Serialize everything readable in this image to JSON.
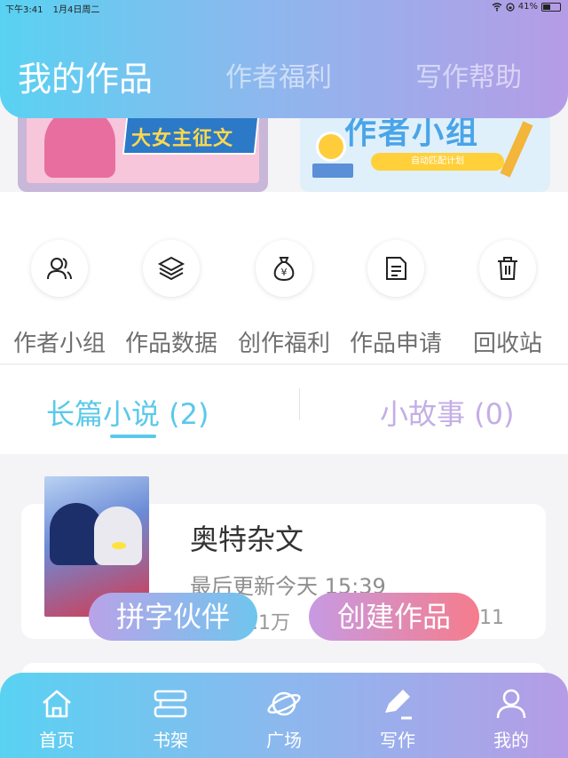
{
  "status_bar": {
    "time": "下午3:41",
    "date": "1月4日周二",
    "battery": "41%"
  },
  "header": {
    "tabs": [
      {
        "label": "我的作品",
        "active": true
      },
      {
        "label": "作者福利",
        "active": false
      },
      {
        "label": "写作帮助",
        "active": false
      }
    ]
  },
  "banners": [
    {
      "title": "大女主征文",
      "accent": "#2c79c7"
    },
    {
      "title": "作者小组",
      "subtitle": "自动匹配计划",
      "accent": "#4aa4e8"
    }
  ],
  "features": [
    {
      "label": "作者小组",
      "icon": "users-icon"
    },
    {
      "label": "作品数据",
      "icon": "layers-icon"
    },
    {
      "label": "创作福利",
      "icon": "money-bag-icon"
    },
    {
      "label": "作品申请",
      "icon": "document-icon"
    },
    {
      "label": "回收站",
      "icon": "trash-icon"
    }
  ],
  "sub_tabs": [
    {
      "label": "长篇小说 (2)",
      "active": true
    },
    {
      "label": "小故事 (0)",
      "active": false
    }
  ],
  "works": [
    {
      "title": "奥特杂文",
      "updated": "最后更新今天 15:39",
      "stat_left": ".1万",
      "stat_right": "11"
    }
  ],
  "floating_buttons": {
    "partner": "拼字伙伴",
    "create": "创建作品"
  },
  "bottom_nav": [
    {
      "label": "首页",
      "icon": "home-icon"
    },
    {
      "label": "书架",
      "icon": "bookshelf-icon"
    },
    {
      "label": "广场",
      "icon": "planet-icon"
    },
    {
      "label": "写作",
      "icon": "pen-icon",
      "active": true
    },
    {
      "label": "我的",
      "icon": "person-icon"
    }
  ],
  "colors": {
    "gradient_start": "#59d2f2",
    "gradient_end": "#b59ce6",
    "accent_blue": "#59c9ea",
    "accent_purple": "#c3aee6"
  }
}
